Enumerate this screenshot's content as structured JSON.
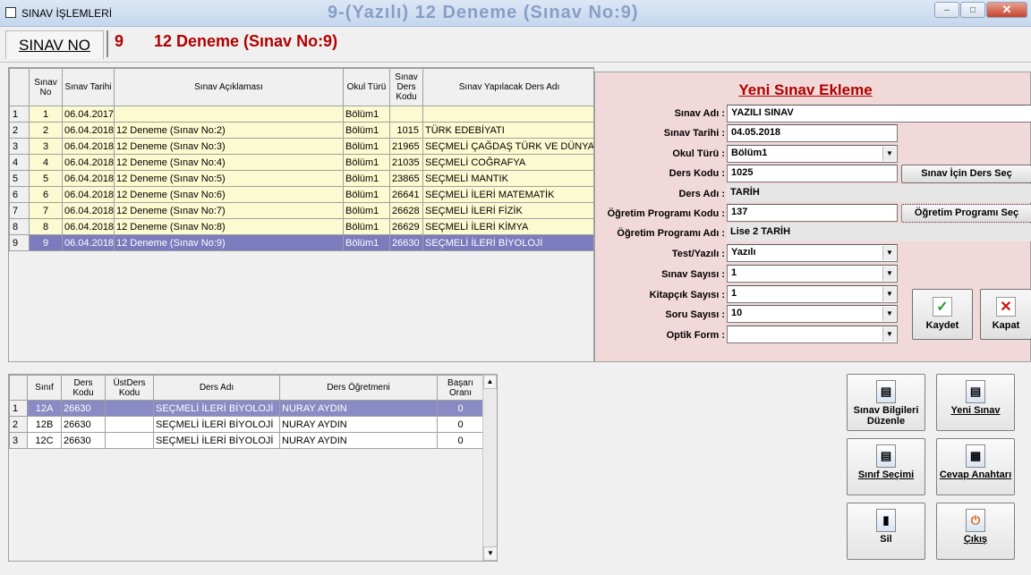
{
  "window": {
    "title": "SINAV İŞLEMLERİ",
    "ghost_title": "9-(Yazılı) 12 Deneme (Sınav No:9)",
    "minimize": "‒",
    "maximize": "□",
    "close": "✕"
  },
  "header": {
    "tab_label": "SINAV NO",
    "exam_no": "9",
    "exam_name": "12 Deneme (Sınav No:9)"
  },
  "exams_grid": {
    "columns": [
      "Sınav No",
      "Sınav Tarihi",
      "Sınav Açıklaması",
      "Okul Türü",
      "Sınav Ders Kodu",
      "Sınav Yapılacak Ders Adı"
    ],
    "rows": [
      {
        "rn": "1",
        "no": "1",
        "date": "06.04.2017",
        "desc": "",
        "school": "Bölüm1",
        "code": "",
        "course": ""
      },
      {
        "rn": "2",
        "no": "2",
        "date": "06.04.2018",
        "desc": "12 Deneme (Sınav No:2)",
        "school": "Bölüm1",
        "code": "1015",
        "course": "TÜRK EDEBİYATI"
      },
      {
        "rn": "3",
        "no": "3",
        "date": "06.04.2018",
        "desc": "12 Deneme (Sınav No:3)",
        "school": "Bölüm1",
        "code": "21965",
        "course": "SEÇMELİ ÇAĞDAŞ TÜRK VE DÜNYA T"
      },
      {
        "rn": "4",
        "no": "4",
        "date": "06.04.2018",
        "desc": "12 Deneme (Sınav No:4)",
        "school": "Bölüm1",
        "code": "21035",
        "course": "SEÇMELİ COĞRAFYA"
      },
      {
        "rn": "5",
        "no": "5",
        "date": "06.04.2018",
        "desc": "12 Deneme (Sınav No:5)",
        "school": "Bölüm1",
        "code": "23865",
        "course": "SEÇMELİ MANTIK"
      },
      {
        "rn": "6",
        "no": "6",
        "date": "06.04.2018",
        "desc": "12 Deneme (Sınav No:6)",
        "school": "Bölüm1",
        "code": "26641",
        "course": "SEÇMELİ İLERİ MATEMATİK"
      },
      {
        "rn": "7",
        "no": "7",
        "date": "06.04.2018",
        "desc": "12 Deneme (Sınav No:7)",
        "school": "Bölüm1",
        "code": "26628",
        "course": "SEÇMELİ İLERİ FİZİK"
      },
      {
        "rn": "8",
        "no": "8",
        "date": "06.04.2018",
        "desc": "12 Deneme (Sınav No:8)",
        "school": "Bölüm1",
        "code": "26629",
        "course": "SEÇMELİ İLERİ KİMYA"
      },
      {
        "rn": "9",
        "no": "9",
        "date": "06.04.2018",
        "desc": "12 Deneme (Sınav No:9)",
        "school": "Bölüm1",
        "code": "26630",
        "course": "SEÇMELİ İLERİ BİYOLOJİ"
      }
    ]
  },
  "form": {
    "title": "Yeni Sınav Ekleme",
    "sinav_adi": {
      "label": "Sınav Adı :",
      "value": "YAZILI SINAV"
    },
    "sinav_tarihi": {
      "label": "Sınav Tarihi :",
      "value": "04.05.2018"
    },
    "okul_turu": {
      "label": "Okul Türü :",
      "value": "Bölüm1"
    },
    "ders_kodu": {
      "label": "Ders Kodu :",
      "value": "1025"
    },
    "ders_sec_button": "Sınav İçin Ders Seç",
    "ders_adi": {
      "label": "Ders Adı :",
      "value": "TARİH"
    },
    "program_kodu": {
      "label": "Öğretim Programı Kodu :",
      "value": "137"
    },
    "program_sec_button": "Öğretim Programı Seç",
    "program_adi": {
      "label": "Öğretim Programı Adı :",
      "value": "Lise 2 TARİH"
    },
    "test_yazili": {
      "label": "Test/Yazılı :",
      "value": "Yazılı"
    },
    "sinav_sayisi": {
      "label": "Sınav Sayısı :",
      "value": "1"
    },
    "kitapcik_sayisi": {
      "label": "Kitapçık Sayısı :",
      "value": "1"
    },
    "soru_sayisi": {
      "label": "Soru Sayısı :",
      "value": "10"
    },
    "optik_form": {
      "label": "Optik Form :",
      "value": ""
    },
    "save_label": "Kaydet",
    "close_label": "Kapat",
    "dropdown_glyph": "▼"
  },
  "classes_grid": {
    "columns": [
      "Sınıf",
      "Ders Kodu",
      "ÜstDers Kodu",
      "Ders Adı",
      "Ders Öğretmeni",
      "Başarı Oranı"
    ],
    "rows": [
      {
        "rn": "1",
        "sinif": "12A",
        "kod": "26630",
        "ust": "",
        "ders": "SEÇMELİ İLERİ BİYOLOJİ",
        "ogretmen": "NURAY AYDIN",
        "oran": "0"
      },
      {
        "rn": "2",
        "sinif": "12B",
        "kod": "26630",
        "ust": "",
        "ders": "SEÇMELİ İLERİ BİYOLOJİ",
        "ogretmen": "NURAY AYDIN",
        "oran": "0"
      },
      {
        "rn": "3",
        "sinif": "12C",
        "kod": "26630",
        "ust": "",
        "ders": "SEÇMELİ İLERİ BİYOLOJİ",
        "ogretmen": "NURAY AYDIN",
        "oran": "0"
      }
    ],
    "scroll_up": "▲",
    "scroll_down": "▼"
  },
  "actions": {
    "duzenle": "Sınav Bilgileri Düzenle",
    "yeni": "Yeni Sınav",
    "sinif_secimi": "Sınıf Seçimi",
    "cevap": "Cevap Anahtarı",
    "sil": "Sil",
    "cikis": "Çıkış"
  },
  "icons": {
    "check": "✓",
    "cross": "✕",
    "doc": "▤",
    "grid": "▦",
    "trash": "▮",
    "power": "⏻"
  },
  "colors": {
    "accent_red": "#b00000",
    "row_yellow": "#fcfad0",
    "row_selected": "#7b7bbd",
    "panel_pink": "#f2d9d9"
  }
}
